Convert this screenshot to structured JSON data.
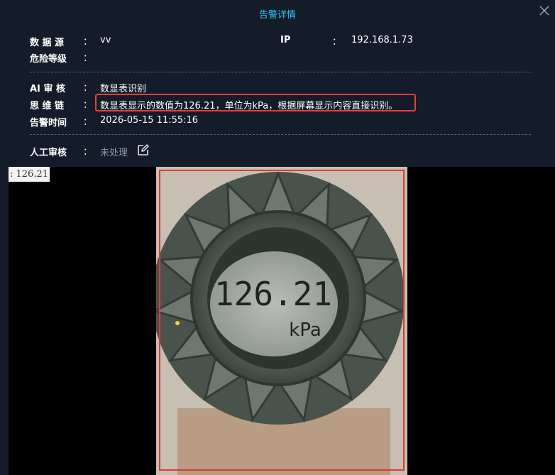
{
  "dialog": {
    "title": "告警详情",
    "close_icon": "close-icon"
  },
  "info": {
    "data_source_label": "数 据 源",
    "data_source_value": "vv",
    "ip_label": "IP",
    "ip_value": "192.168.1.73",
    "risk_label": "危险等级",
    "risk_value": "",
    "ai_review_label": "AI 审 核",
    "ai_review_value": "数显表识别",
    "reasoning_label": "思 维 链",
    "reasoning_value": "数显表显示的数值为126.21，单位为kPa，根据屏幕显示内容直接识别。",
    "alarm_time_label": "告警时间",
    "alarm_time_value": "2026-05-15 11:55:16",
    "manual_review_label": "人工审核",
    "manual_review_value": "未处理",
    "colon": "："
  },
  "image": {
    "detection_tag": ": 126.21",
    "meter_reading": "126.21",
    "meter_unit": "kPa"
  },
  "colors": {
    "title": "#2cc7f5",
    "highlight_border": "#e03a35",
    "background": "#141b29"
  }
}
